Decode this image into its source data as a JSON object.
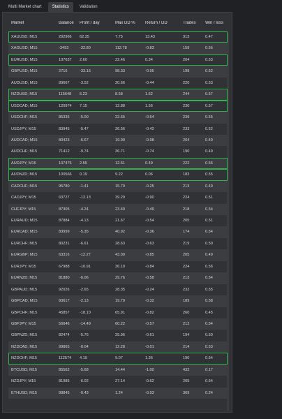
{
  "tabs": [
    {
      "label": "Multi Market chart"
    },
    {
      "label": "Statistics"
    },
    {
      "label": "Validation"
    }
  ],
  "active_tab": 1,
  "table": {
    "headers": [
      "Market",
      "Balance",
      "Profit / day",
      "Max DD %",
      "Return / DD",
      "Trades",
      "Win / loss"
    ],
    "rows": [
      {
        "cells": [
          "XAUUSD; M15",
          "292966",
          "62.35",
          "7.75",
          "13.43",
          "313",
          "0.47"
        ],
        "highlight": true
      },
      {
        "cells": [
          "XAGUSD; M15",
          "-3493",
          "-32.80",
          "112.78",
          "-0.83",
          "159",
          "0.56"
        ],
        "highlight": false
      },
      {
        "cells": [
          "EURUSD; M15",
          "107637",
          "2.60",
          "22.46",
          "0.34",
          "204",
          "0.53"
        ],
        "highlight": true
      },
      {
        "cells": [
          "GBPUSD; M15",
          "2716",
          "-33.16",
          "98.33",
          "-0.95",
          "198",
          "0.52"
        ],
        "highlight": false
      },
      {
        "cells": [
          "AUDUSD; M15",
          "89667",
          "-3.52",
          "20.66",
          "-0.44",
          "220",
          "0.53"
        ],
        "highlight": false
      },
      {
        "cells": [
          "NZDUSD; M15",
          "115648",
          "5.23",
          "8.58",
          "1.62",
          "244",
          "0.57"
        ],
        "highlight": true
      },
      {
        "cells": [
          "USDCAD; M15",
          "120974",
          "7.15",
          "12.88",
          "1.56",
          "230",
          "0.57"
        ],
        "highlight": true
      },
      {
        "cells": [
          "USDCHF; M15",
          "85336",
          "-5.00",
          "22.65",
          "-0.64",
          "239",
          "0.55"
        ],
        "highlight": false
      },
      {
        "cells": [
          "USDJPY; M15",
          "83945",
          "-5.47",
          "36.56",
          "-0.42",
          "233",
          "0.52"
        ],
        "highlight": false
      },
      {
        "cells": [
          "AUDCAD; M15",
          "80423",
          "-6.67",
          "19.99",
          "-0.98",
          "204",
          "0.49"
        ],
        "highlight": false
      },
      {
        "cells": [
          "AUDCHF; M15",
          "71412",
          "-9.74",
          "36.71",
          "-0.74",
          "190",
          "0.49"
        ],
        "highlight": false
      },
      {
        "cells": [
          "AUDJPY; M15",
          "107476",
          "2.55",
          "12.61",
          "0.49",
          "222",
          "0.56"
        ],
        "highlight": true
      },
      {
        "cells": [
          "AUDNZD; M15",
          "100566",
          "0.19",
          "9.22",
          "0.06",
          "183",
          "0.55"
        ],
        "highlight": true
      },
      {
        "cells": [
          "CADCHF; M15",
          "95780",
          "-1.41",
          "15.70",
          "-0.25",
          "213",
          "0.49"
        ],
        "highlight": false
      },
      {
        "cells": [
          "CADJPY; M15",
          "63727",
          "-12.13",
          "39.29",
          "-0.90",
          "224",
          "0.51"
        ],
        "highlight": false
      },
      {
        "cells": [
          "CHFJPY; M15",
          "87305",
          "-4.24",
          "23.49",
          "-0.49",
          "218",
          "0.54"
        ],
        "highlight": false
      },
      {
        "cells": [
          "EURAUD; M15",
          "87884",
          "-4.13",
          "21.67",
          "-0.54",
          "205",
          "0.51"
        ],
        "highlight": false
      },
      {
        "cells": [
          "EURCAD; M15",
          "83999",
          "-5.35",
          "40.92",
          "-0.36",
          "174",
          "0.54"
        ],
        "highlight": false
      },
      {
        "cells": [
          "EURCHF; M15",
          "80231",
          "-6.61",
          "28.63",
          "-0.63",
          "219",
          "0.50"
        ],
        "highlight": false
      },
      {
        "cells": [
          "EURGBP; M15",
          "63316",
          "-12.27",
          "43.00",
          "-0.85",
          "205",
          "0.49"
        ],
        "highlight": false
      },
      {
        "cells": [
          "EURJPY; M15",
          "67988",
          "-10.91",
          "36.10",
          "-0.84",
          "224",
          "0.56"
        ],
        "highlight": false
      },
      {
        "cells": [
          "EURNZD; M15",
          "81880",
          "-6.06",
          "29.76",
          "-0.58",
          "213",
          "0.54"
        ],
        "highlight": false
      },
      {
        "cells": [
          "GBPAUD; M15",
          "92026",
          "-2.65",
          "28.35",
          "-0.24",
          "232",
          "0.55"
        ],
        "highlight": false
      },
      {
        "cells": [
          "GBPCAD; M15",
          "93617",
          "-2.13",
          "19.70",
          "-0.32",
          "189",
          "0.58"
        ],
        "highlight": false
      },
      {
        "cells": [
          "GBPCHF; M15",
          "45857",
          "-18.10",
          "65.91",
          "-0.82",
          "260",
          "0.45"
        ],
        "highlight": false
      },
      {
        "cells": [
          "GBPJPY; M15",
          "56646",
          "-14.49",
          "60.22",
          "-0.57",
          "212",
          "0.54"
        ],
        "highlight": false
      },
      {
        "cells": [
          "GBPNZD; M15",
          "82474",
          "-5.76",
          "25.96",
          "-0.61",
          "194",
          "0.50"
        ],
        "highlight": false
      },
      {
        "cells": [
          "NZDCAD; M15",
          "99865",
          "-0.04",
          "12.28",
          "-0.01",
          "214",
          "0.53"
        ],
        "highlight": false
      },
      {
        "cells": [
          "NZDCHF; M15",
          "112574",
          "4.19",
          "9.07",
          "1.36",
          "190",
          "0.54"
        ],
        "highlight": true
      },
      {
        "cells": [
          "BTCUSD; M15",
          "85562",
          "-5.68",
          "14.44",
          "-1.00",
          "432",
          "0.17"
        ],
        "highlight": false
      },
      {
        "cells": [
          "NZDJPY; M15",
          "81985",
          "-6.02",
          "27.14",
          "-0.62",
          "205",
          "0.54"
        ],
        "highlight": false
      },
      {
        "cells": [
          "ETHUSD; M15",
          "98845",
          "-0.43",
          "1.24",
          "-0.93",
          "369",
          "0.24"
        ],
        "highlight": false
      }
    ]
  },
  "colors": {
    "background": "#202124",
    "panel": "#303236",
    "row_alt": "#3b3d41",
    "highlight": "#2fb34a"
  }
}
